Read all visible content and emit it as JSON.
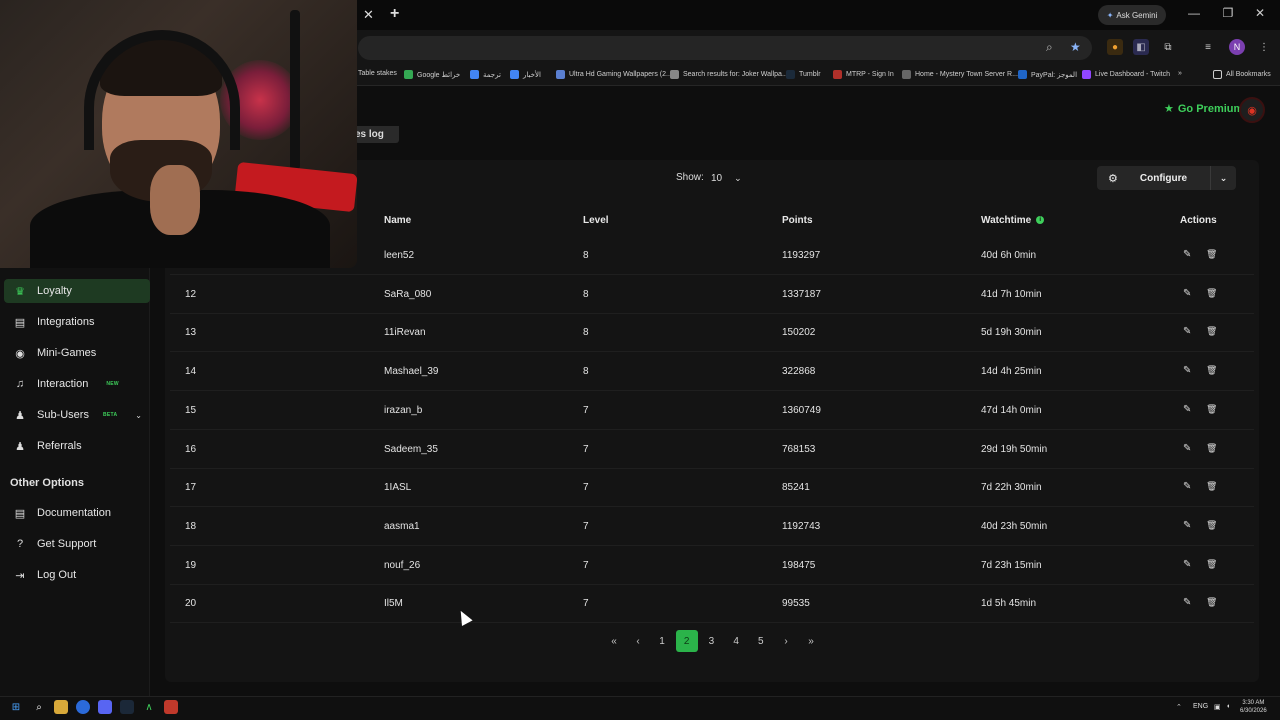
{
  "browser": {
    "gemini_label": "Ask Gemini",
    "profile_initial": "N",
    "bookmarks": [
      {
        "label": "Table stakes",
        "color": "#555555"
      },
      {
        "label": "Google خرائط",
        "color": "#34a853"
      },
      {
        "label": "ترجمة",
        "color": "#4285f4"
      },
      {
        "label": "الأخبار",
        "color": "#4285f4"
      },
      {
        "label": "Ultra Hd Gaming Wallpapers (2...",
        "color": "#5a7fd1"
      },
      {
        "label": "Search results for: Joker Wallpa...",
        "color": "#888888"
      },
      {
        "label": "Tumblr",
        "color": "#1b2a3a"
      },
      {
        "label": "MTRP - Sign In",
        "color": "#b0302a"
      },
      {
        "label": "Home - Mystery Town Server R...",
        "color": "#666666"
      },
      {
        "label": "PayPal: الموجز",
        "color": "#1f65c7"
      },
      {
        "label": "Live Dashboard - Twitch",
        "color": "#9146ff"
      }
    ],
    "all_bookmarks": "All Bookmarks"
  },
  "app": {
    "go_premium": "Go Premium",
    "tab_partial": "es log"
  },
  "sidebar": {
    "items": [
      {
        "label": "Loyalty",
        "icon": "trophy-icon",
        "active": true
      },
      {
        "label": "Integrations",
        "icon": "puzzle-icon"
      },
      {
        "label": "Mini-Games",
        "icon": "gamepad-icon"
      },
      {
        "label": "Interaction",
        "icon": "music-icon",
        "badge": "NEW"
      },
      {
        "label": "Sub-Users",
        "icon": "users-icon",
        "badge": "BETA"
      },
      {
        "label": "Referrals",
        "icon": "user-group-icon"
      }
    ],
    "section_label": "Other Options",
    "other": [
      {
        "label": "Documentation",
        "icon": "book-icon"
      },
      {
        "label": "Get Support",
        "icon": "question-icon"
      },
      {
        "label": "Log Out",
        "icon": "logout-icon"
      }
    ]
  },
  "controls": {
    "show_label": "Show:",
    "show_value": "10",
    "configure_label": "Configure"
  },
  "table": {
    "headers": {
      "name": "Name",
      "level": "Level",
      "points": "Points",
      "watchtime": "Watchtime",
      "actions": "Actions"
    },
    "rows": [
      {
        "rank": "",
        "name": "leen52",
        "level": "8",
        "points": "1193297",
        "watchtime": "40d 6h 0min"
      },
      {
        "rank": "12",
        "name": "SaRa_080",
        "level": "8",
        "points": "1337187",
        "watchtime": "41d 7h 10min"
      },
      {
        "rank": "13",
        "name": "11iRevan",
        "level": "8",
        "points": "150202",
        "watchtime": "5d 19h 30min"
      },
      {
        "rank": "14",
        "name": "Mashael_39",
        "level": "8",
        "points": "322868",
        "watchtime": "14d 4h 25min"
      },
      {
        "rank": "15",
        "name": "irazan_b",
        "level": "7",
        "points": "1360749",
        "watchtime": "47d 14h 0min"
      },
      {
        "rank": "16",
        "name": "Sadeem_35",
        "level": "7",
        "points": "768153",
        "watchtime": "29d 19h 50min"
      },
      {
        "rank": "17",
        "name": "1IASL",
        "level": "7",
        "points": "85241",
        "watchtime": "7d 22h 30min"
      },
      {
        "rank": "18",
        "name": "aasma1",
        "level": "7",
        "points": "1192743",
        "watchtime": "40d 23h 50min"
      },
      {
        "rank": "19",
        "name": "nouf_26",
        "level": "7",
        "points": "198475",
        "watchtime": "7d 23h 15min"
      },
      {
        "rank": "20",
        "name": "Il5M",
        "level": "7",
        "points": "99535",
        "watchtime": "1d 5h 45min"
      }
    ]
  },
  "pagination": {
    "first": "«",
    "prev": "‹",
    "pages": [
      "1",
      "2",
      "3",
      "4",
      "5"
    ],
    "current": "2",
    "next": "›",
    "last": "»"
  },
  "taskbar": {
    "lang": "ENG",
    "time": "3:30 AM",
    "date": "6/30/2026"
  }
}
